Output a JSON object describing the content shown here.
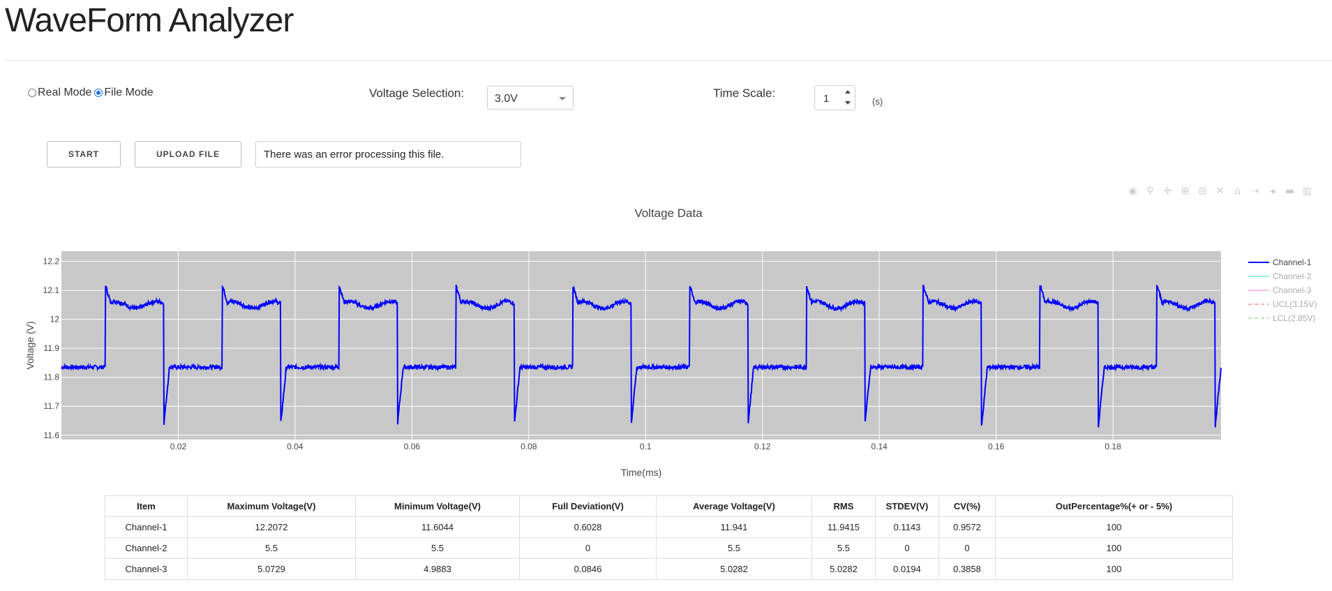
{
  "app": {
    "title": "WaveForm Analyzer"
  },
  "controls": {
    "modes": [
      {
        "label": "Real Mode",
        "checked": false
      },
      {
        "label": "File Mode",
        "checked": true
      }
    ],
    "voltage_selection_label": "Voltage Selection:",
    "voltage_selection_value": "3.0V",
    "time_scale_label": "Time Scale:",
    "time_scale_value": "1",
    "time_scale_unit": "(s)",
    "start_label": "START",
    "upload_label": "UPLOAD FILE",
    "status_message": "There was an error processing this file."
  },
  "modebar_icons": [
    "camera-icon",
    "zoom-icon",
    "pan-icon",
    "zoom-in-icon",
    "zoom-out-icon",
    "autoscale-icon",
    "reset-axes-icon",
    "spike-lines-icon",
    "hover-closest-icon",
    "hover-compare-icon",
    "plotly-logo-icon"
  ],
  "chart_data": {
    "type": "line",
    "title": "Voltage Data",
    "xlabel": "Time(ms)",
    "ylabel": "Voltage (V)",
    "xlim": [
      0,
      0.1985
    ],
    "ylim": [
      11.585,
      12.235
    ],
    "xticks": [
      0.02,
      0.04,
      0.06,
      0.08,
      0.1,
      0.12,
      0.14,
      0.16,
      0.18
    ],
    "xtick_labels": [
      "0.02",
      "0.04",
      "0.06",
      "0.08",
      "0.1",
      "0.12",
      "0.14",
      "0.16",
      "0.18"
    ],
    "yticks": [
      11.6,
      11.7,
      11.8,
      11.9,
      12.0,
      12.1,
      12.2
    ],
    "ytick_labels": [
      "11.6",
      "11.7",
      "11.8",
      "11.9",
      "12",
      "12.1",
      "12.2"
    ],
    "grid": true,
    "plot_background": "#c8c8c8",
    "legend_position": "right",
    "series": [
      {
        "name": "Channel-1",
        "color": "#0000ff",
        "dash": "solid",
        "waveform": {
          "period": 0.02,
          "phase": 0.0075,
          "high_level": 12.05,
          "low_level": 11.835,
          "rise_overshoot": 12.12,
          "fall_undershoot": 11.63,
          "high_duty": 0.5
        },
        "x_range": [
          0,
          0.1985
        ]
      },
      {
        "name": "Channel-2",
        "color": "#40e0d0",
        "dash": "solid"
      },
      {
        "name": "Channel-3",
        "color": "#ee82ee",
        "dash": "solid"
      },
      {
        "name": "UCL(3.15V)",
        "color": "#ff6666",
        "dash": "dash"
      },
      {
        "name": "LCL(2.85V)",
        "color": "#66dd66",
        "dash": "dash"
      }
    ]
  },
  "stats_table": {
    "headers": [
      "Item",
      "Maximum Voltage(V)",
      "Minimum Voltage(V)",
      "Full Deviation(V)",
      "Average Voltage(V)",
      "RMS",
      "STDEV(V)",
      "CV(%)",
      "OutPercentage%(+ or - 5%)"
    ],
    "rows": [
      [
        "Channel-1",
        "12.2072",
        "11.6044",
        "0.6028",
        "11.941",
        "11.9415",
        "0.1143",
        "0.9572",
        "100"
      ],
      [
        "Channel-2",
        "5.5",
        "5.5",
        "0",
        "5.5",
        "5.5",
        "0",
        "0",
        "100"
      ],
      [
        "Channel-3",
        "5.0729",
        "4.9883",
        "0.0846",
        "5.0282",
        "5.0282",
        "0.0194",
        "0.3858",
        "100"
      ]
    ]
  }
}
